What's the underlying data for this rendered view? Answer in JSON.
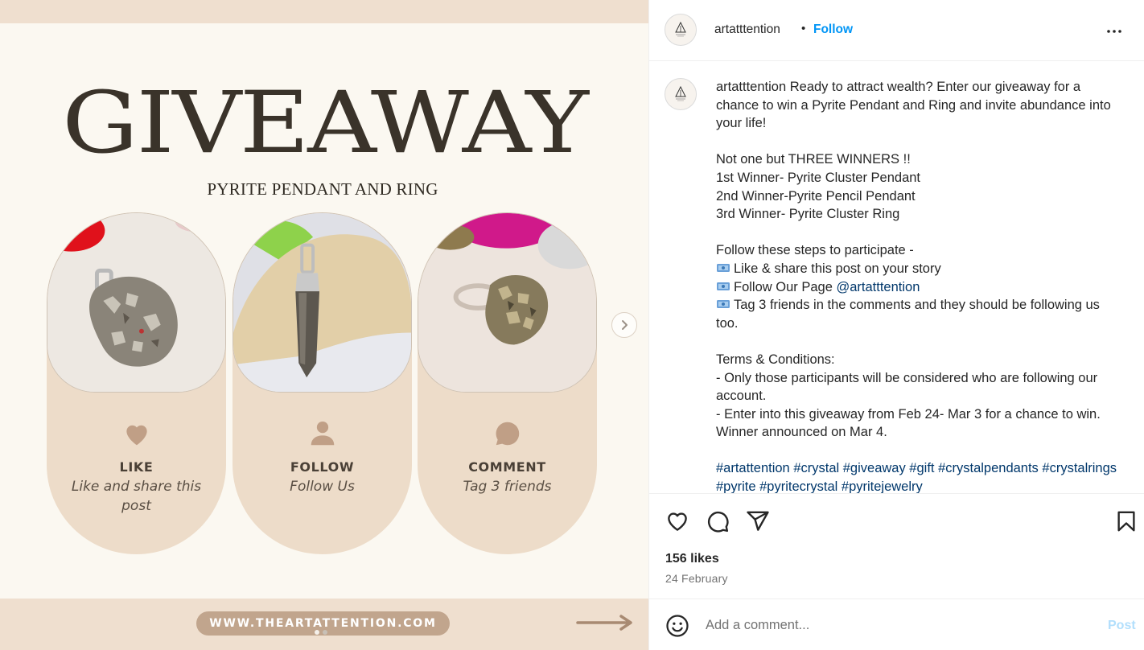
{
  "media": {
    "title": "GIVEAWAY",
    "subtitle": "PYRITE PENDANT AND RING",
    "cards": [
      {
        "icon": "heart-icon",
        "heading": "LIKE",
        "text": "Like and share this post"
      },
      {
        "icon": "person-icon",
        "heading": "FOLLOW",
        "text": "Follow Us"
      },
      {
        "icon": "speech-bubble-icon",
        "heading": "COMMENT",
        "text": "Tag 3 friends"
      }
    ],
    "website": "WWW.THEARTATTENTION.COM",
    "carousel": {
      "current": 1,
      "total": 2
    }
  },
  "post_header": {
    "username": "artatttention",
    "separator": "•",
    "follow_label": "Follow"
  },
  "caption": {
    "username": "artatttention",
    "intro": "Ready to attract wealth? Enter our giveaway for a chance to win a Pyrite Pendant and Ring and invite abundance into your life!",
    "winners_title": "Not one but THREE WINNERS !!",
    "winner_1": "1st Winner- Pyrite Cluster Pendant",
    "winner_2": "2nd Winner-Pyrite Pencil Pendant",
    "winner_3": "3rd Winner- Pyrite Cluster Ring",
    "steps_title": "Follow these steps to participate -",
    "step_1": "Like & share this post on your story",
    "step_2_prefix": "Follow Our Page ",
    "step_2_mention": "@artatttention",
    "step_3": "Tag 3 friends in the comments and they should be following us too.",
    "terms_title": "Terms & Conditions:",
    "term_1": "- Only those participants will be considered who are following our account.",
    "term_2": "- Enter into this giveaway from Feb 24- Mar 3 for a chance to win. Winner announced on Mar 4.",
    "hashtags": "#artattention #crystal #giveaway #gift #crystalpendants #crystalrings #pyrite #pyritecrystal #pyritejewelry"
  },
  "stats": {
    "likes": "156 likes",
    "date": "24 February"
  },
  "comment": {
    "placeholder": "Add a comment...",
    "post_label": "Post"
  },
  "colors": {
    "accent": "#0095f6",
    "hashtag": "#00376b",
    "card_bg": "#eddcc9",
    "card_icon": "#c09f86",
    "band": "#efdfcf",
    "pill": "#c1a58d"
  }
}
